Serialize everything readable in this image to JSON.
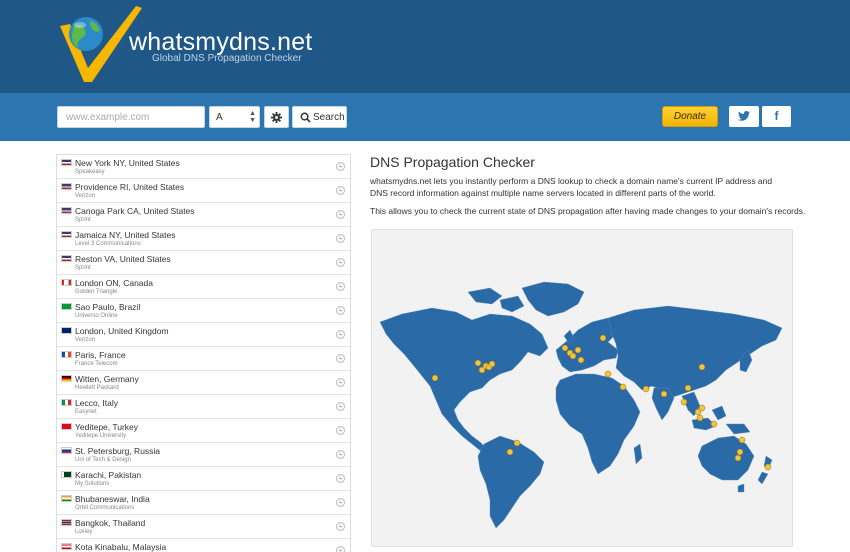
{
  "brand": {
    "title": "whatsmydns.net",
    "subtitle": "Global DNS Propagation Checker",
    "colors": {
      "header": "#1f5787",
      "searchbar": "#2c75b1",
      "logo_check": "#f5b700",
      "logo_globe": "#2d8ac9",
      "map_land": "#2a6aa6",
      "map_marker": "#f5c33b",
      "donate": "#f7c11c"
    }
  },
  "search": {
    "placeholder": "www.example.com",
    "value": "",
    "record_type": "A",
    "settings_icon": "gear-icon",
    "search_icon": "search-icon",
    "search_label": "Search"
  },
  "header_actions": {
    "donate_label": "Donate",
    "twitter_icon": "twitter-icon",
    "facebook_icon": "facebook-icon",
    "facebook_glyph": "f"
  },
  "locations": [
    {
      "name": "New York NY, United States",
      "isp": "Speakeasy",
      "flag": "us"
    },
    {
      "name": "Providence RI, United States",
      "isp": "Verizon",
      "flag": "us"
    },
    {
      "name": "Canoga Park CA, United States",
      "isp": "Sprint",
      "flag": "us"
    },
    {
      "name": "Jamaica NY, United States",
      "isp": "Level 3 Communications",
      "flag": "us"
    },
    {
      "name": "Reston VA, United States",
      "isp": "Sprint",
      "flag": "us"
    },
    {
      "name": "London ON, Canada",
      "isp": "Golden Triangle",
      "flag": "ca"
    },
    {
      "name": "Sao Paulo, Brazil",
      "isp": "Universo Online",
      "flag": "br"
    },
    {
      "name": "London, United Kingdom",
      "isp": "Verizon",
      "flag": "gb"
    },
    {
      "name": "Paris, France",
      "isp": "France Telecom",
      "flag": "fr"
    },
    {
      "name": "Witten, Germany",
      "isp": "Hewlett Packard",
      "flag": "de"
    },
    {
      "name": "Lecco, Italy",
      "isp": "Easynet",
      "flag": "it"
    },
    {
      "name": "Yeditepe, Turkey",
      "isp": "Yeditepe University",
      "flag": "tr"
    },
    {
      "name": "St. Petersburg, Russia",
      "isp": "Uni of Tech & Design",
      "flag": "ru"
    },
    {
      "name": "Karachi, Pakistan",
      "isp": "My Solutions",
      "flag": "pk"
    },
    {
      "name": "Bhubaneswar, India",
      "isp": "Ortel Communications",
      "flag": "in"
    },
    {
      "name": "Bangkok, Thailand",
      "isp": "Loxley",
      "flag": "th"
    },
    {
      "name": "Kota Kinabalu, Malaysia",
      "isp": "",
      "flag": "my"
    }
  ],
  "main": {
    "title": "DNS Propagation Checker",
    "description": "whatsmydns.net lets you instantly perform a DNS lookup to check a domain name's current IP address and DNS record information against multiple name servers located in different parts of the world.",
    "description2": "This allows you to check the current state of DNS propagation after having made changes to your domain's records."
  }
}
